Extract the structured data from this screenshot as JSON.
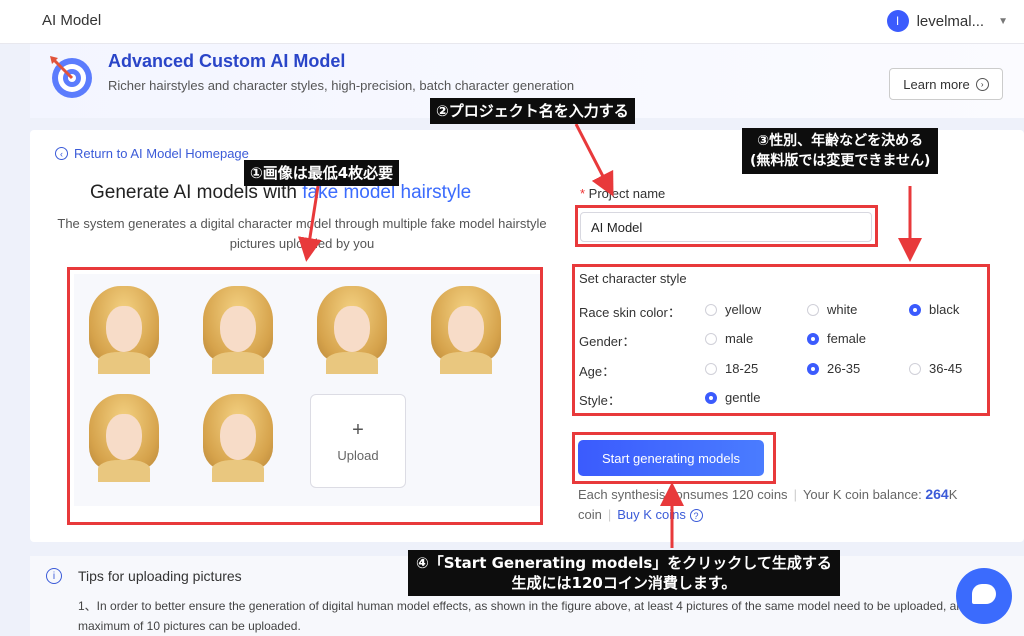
{
  "header": {
    "title": "AI Model",
    "avatar_letter": "l",
    "username": "levelmal..."
  },
  "banner": {
    "title": "Advanced Custom AI Model",
    "subtitle": "Richer hairstyles and character styles, high-precision, batch character generation",
    "learn_more": "Learn more"
  },
  "left": {
    "back_link": "Return to AI Model Homepage",
    "title_prefix": "Generate AI models with ",
    "title_highlight": "fake model hairstyle",
    "description": "The system generates a digital character model through multiple fake model hairstyle pictures uploaded by you",
    "upload_label": "Upload",
    "photo_count": 6
  },
  "form": {
    "project_label": "Project name",
    "project_value": "AI Model",
    "style_title": "Set character style",
    "rows": [
      {
        "label": "Race skin color：",
        "options": [
          {
            "text": "yellow",
            "selected": false
          },
          {
            "text": "white",
            "selected": false
          },
          {
            "text": "black",
            "selected": true
          }
        ]
      },
      {
        "label": "Gender：",
        "options": [
          {
            "text": "male",
            "selected": false
          },
          {
            "text": "female",
            "selected": true
          }
        ]
      },
      {
        "label": "Age：",
        "options": [
          {
            "text": "18-25",
            "selected": false
          },
          {
            "text": "26-35",
            "selected": true
          },
          {
            "text": "36-45",
            "selected": false
          }
        ]
      },
      {
        "label": "Style：",
        "options": [
          {
            "text": "gentle",
            "selected": true
          }
        ]
      }
    ],
    "start_button": "Start generating models",
    "consume_text": "Each synthesis consumes 120 coins",
    "balance_label": "Your K coin balance: ",
    "balance_value": "264",
    "balance_unit": "K coin",
    "buy_link": "Buy K coins"
  },
  "tips": {
    "title": "Tips for uploading pictures",
    "text": "1、In order to better ensure the generation of digital human model effects, as shown in the figure above, at least 4 pictures of the same model need to be uploaded, and a maximum of 10 pictures can be uploaded."
  },
  "annotations": {
    "note1": "①画像は最低4枚必要",
    "note2": "②プロジェクト名を入力する",
    "note3_line1": "③性別、年齢などを決める",
    "note3_line2": "(無料版では変更できません)",
    "note4_line1": "④「Start Generating models」をクリックして生成する",
    "note4_line2": "生成には120コイン消費します。"
  },
  "colors": {
    "accent": "#3b5bfd",
    "annotation_red": "#e8393b",
    "annotation_bg": "#0d0d0d"
  }
}
